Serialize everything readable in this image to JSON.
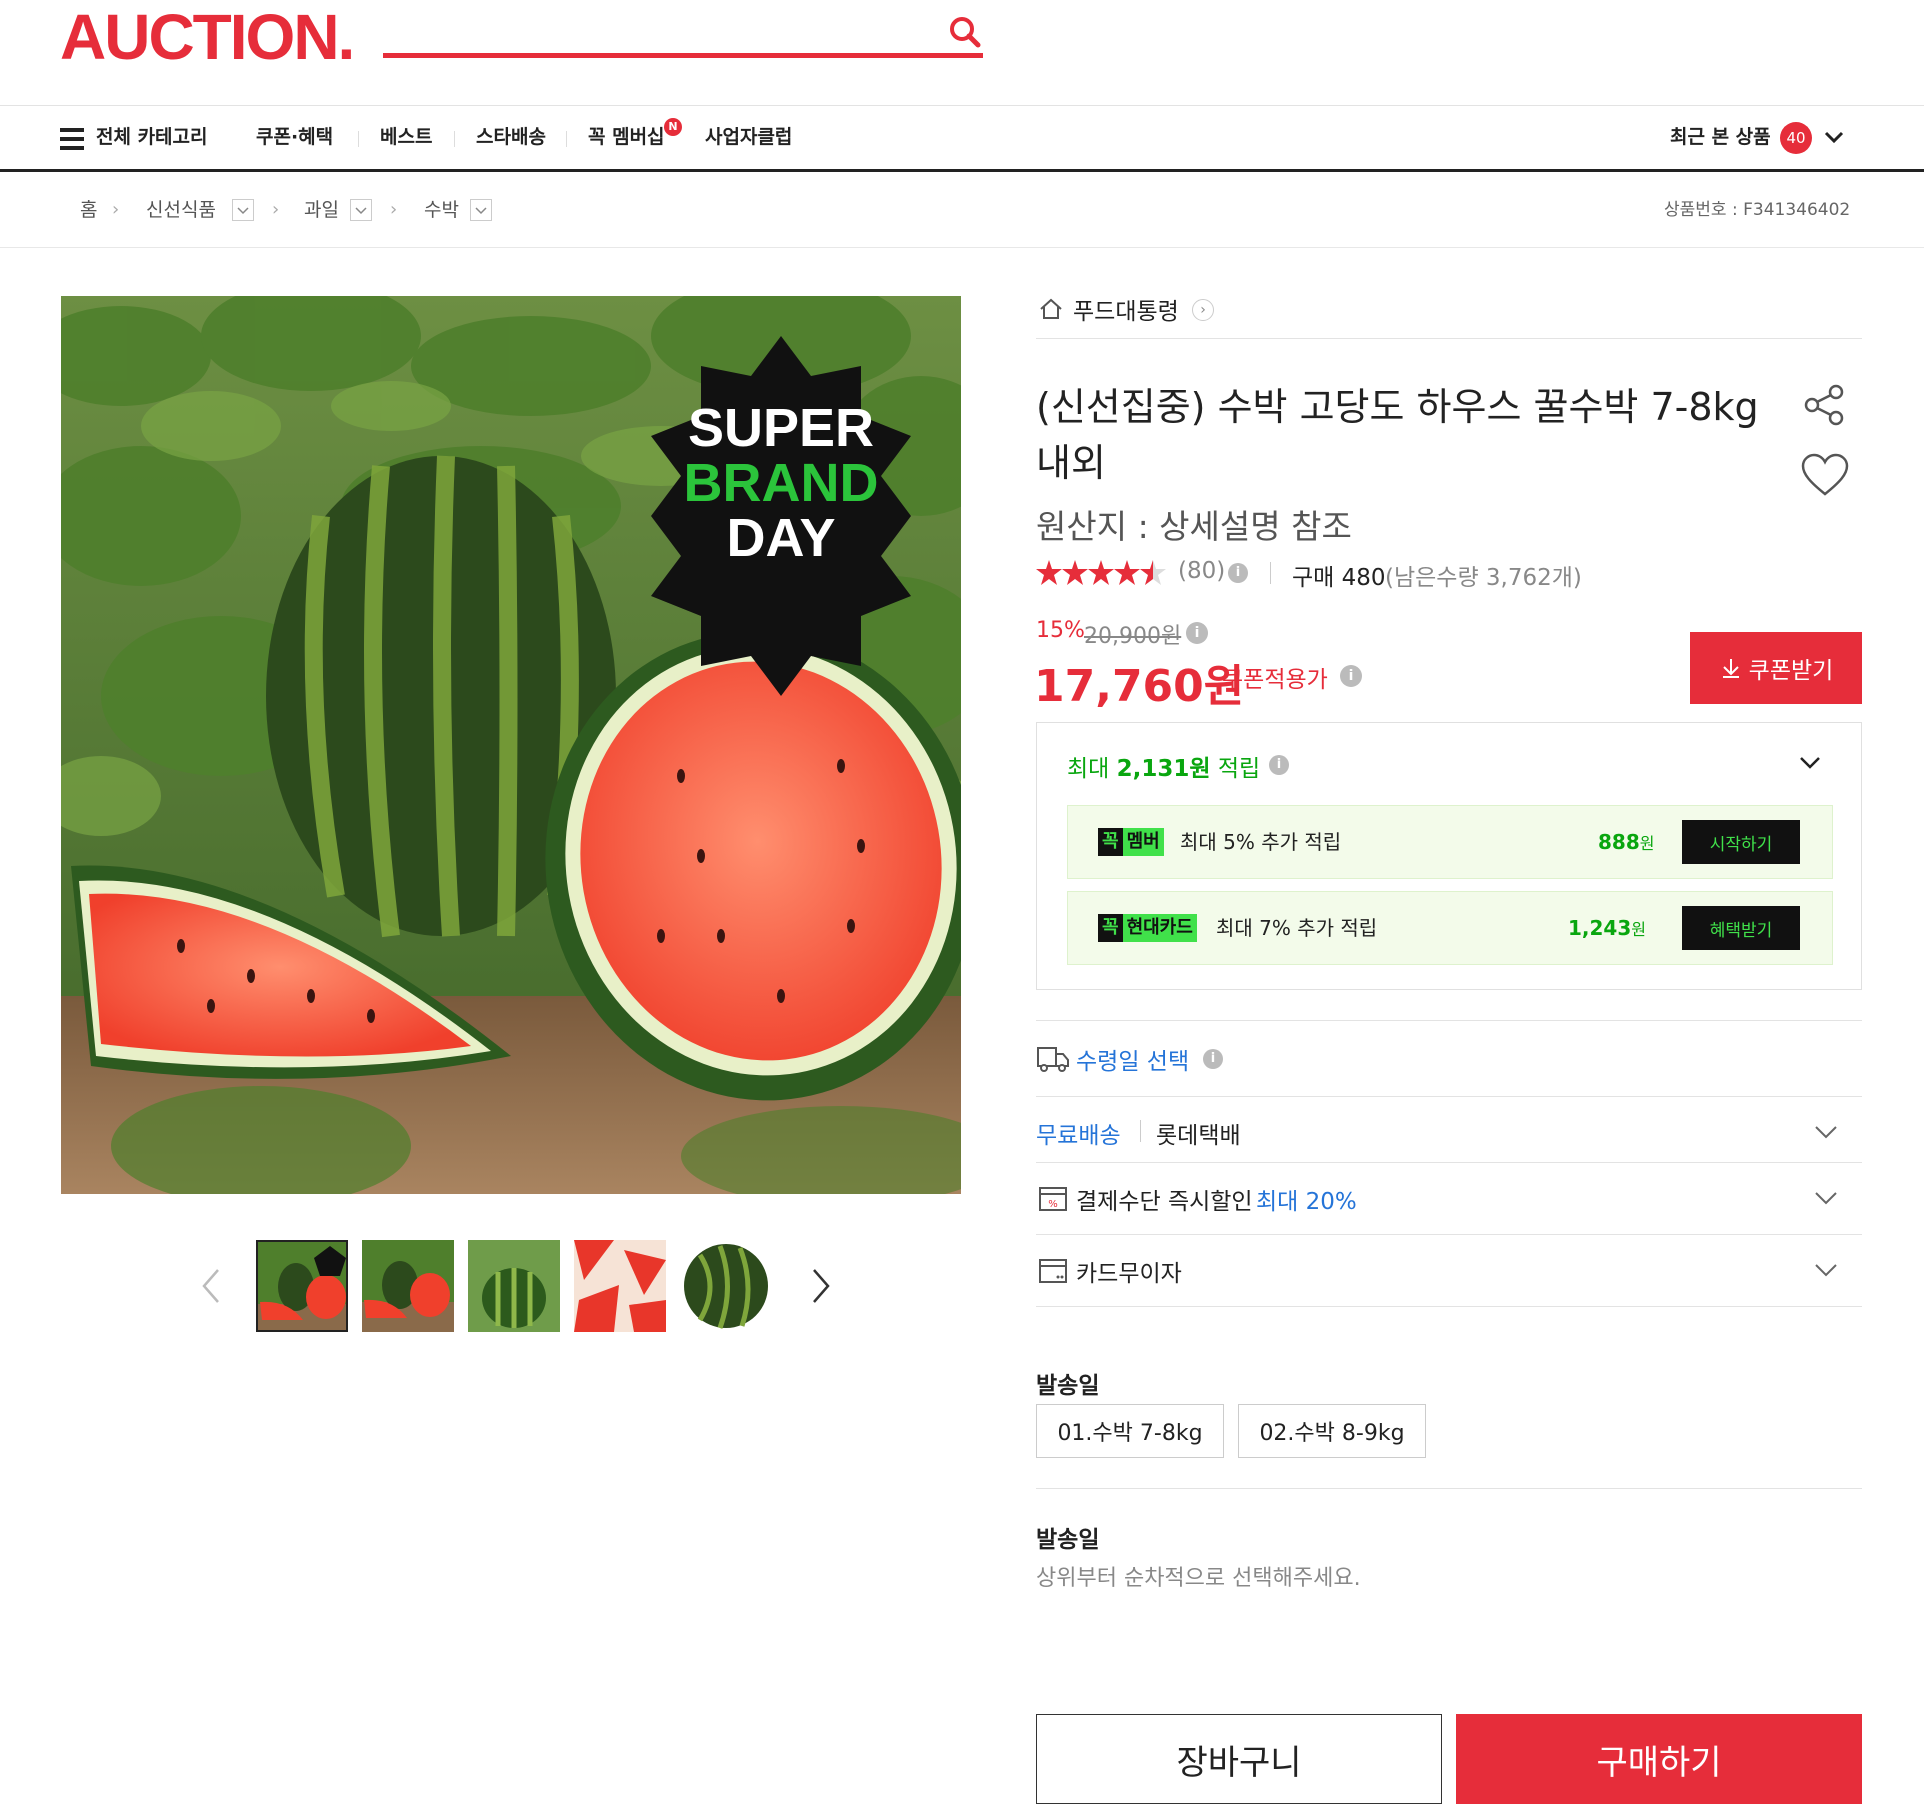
{
  "header": {
    "logo": "AUCTION.",
    "search_placeholder": ""
  },
  "nav": {
    "all_categories": "전체 카테고리",
    "items": [
      "쿠폰·혜택",
      "베스트",
      "스타배송",
      "꼭 멤버십",
      "사업자클럽"
    ],
    "membership_badge": "N",
    "recent_label": "최근 본 상품",
    "recent_count": "40"
  },
  "breadcrumb": {
    "items": [
      "홈",
      "신선식품",
      "과일",
      "수박"
    ],
    "product_no": "상품번호 : F341346402"
  },
  "image": {
    "badge_line1": "SUPER",
    "badge_line2": "BRAND",
    "badge_line3": "DAY"
  },
  "seller": {
    "name": "푸드대통령"
  },
  "product": {
    "title_line1": "(신선집중) 수박 고당도 하우스 꿀수박 7-8kg",
    "title_line2": "내외",
    "origin": "원산지 : 상세설명 참조",
    "rating": 4.5,
    "review_count": "(80)",
    "purchase_label": "구매 480",
    "stock_label": "(남은수량 3,762개)",
    "discount": "15%",
    "original_price": "20,900원",
    "price": "17,760원",
    "coupon_price_label": "쿠폰적용가",
    "coupon_button": "쿠폰받기"
  },
  "points": {
    "title_prefix": "최대 ",
    "title_amount": "2,131원",
    "title_suffix": " 적립",
    "rows": [
      {
        "tag_a": "꼭",
        "tag_b": "멤버",
        "desc": "최대 5% 추가 적립",
        "amount": "888",
        "unit": "원",
        "button": "시작하기"
      },
      {
        "tag_a": "꼭",
        "tag_b": "현대카드",
        "desc": "최대 7% 추가 적립",
        "amount": "1,243",
        "unit": "원",
        "button": "혜택받기"
      }
    ]
  },
  "delivery": {
    "receive_date": "수령일 선택",
    "free_shipping": "무료배송",
    "courier": "롯데택배",
    "payment_discount": "결제수단 즉시할인",
    "payment_max": "최대 20%",
    "installment": "카드무이자"
  },
  "options": {
    "section1_title": "발송일",
    "choices": [
      "01.수박 7-8kg",
      "02.수박 8-9kg"
    ],
    "section2_title": "발송일",
    "section2_hint": "상위부터 순차적으로 선택해주세요."
  },
  "actions": {
    "cart": "장바구니",
    "buy": "구매하기"
  },
  "colors": {
    "brand": "#e62d3a",
    "green": "#09a60f",
    "blue": "#2574d8"
  }
}
